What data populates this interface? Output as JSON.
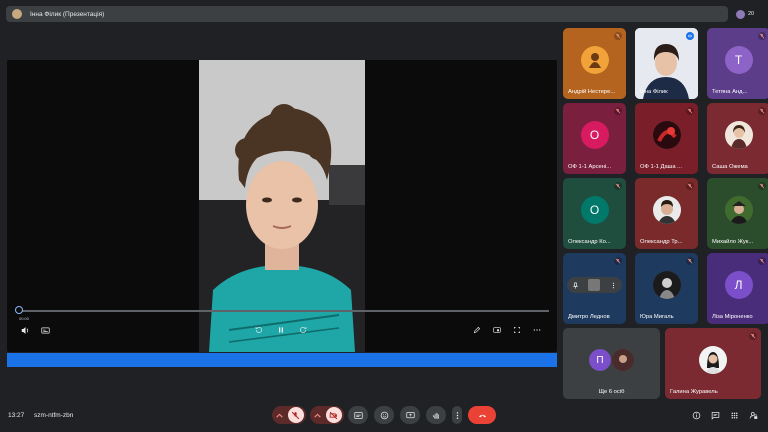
{
  "topbar": {
    "presentation_title": "Інна Філик (Презентація)",
    "people_count": "20"
  },
  "video": {
    "time": "00:00",
    "progress_fraction": 0.0
  },
  "participants": [
    {
      "name": "Андрій Нестере...",
      "avatar_type": "photo",
      "tile_color": "#b4641e",
      "muted": true
    },
    {
      "name": "Інна Філик",
      "avatar_type": "photo",
      "tile_color": "#d8dde6",
      "muted": false,
      "speaking": true,
      "selected": true
    },
    {
      "name": "Тетяна Анд...",
      "avatar_type": "letter",
      "letter": "Т",
      "tile_color": "#5b3d8a",
      "avatar_color": "#8e63c7",
      "muted": true
    },
    {
      "name": "ОФ 1-1 Арсені...",
      "avatar_type": "letter",
      "letter": "О",
      "tile_color": "#7a1f3d",
      "avatar_color": "#d81b60",
      "muted": true
    },
    {
      "name": "ОФ 1-1 Даша ...",
      "avatar_type": "photo",
      "tile_color": "#7a1f2a",
      "muted": true
    },
    {
      "name": "Саша Ожема",
      "avatar_type": "photo",
      "tile_color": "#7a2a30",
      "muted": true
    },
    {
      "name": "Олександр Ко...",
      "avatar_type": "letter",
      "letter": "О",
      "tile_color": "#1f4d3e",
      "avatar_color": "#00796b",
      "muted": true
    },
    {
      "name": "Олександр Тр...",
      "avatar_type": "photo",
      "tile_color": "#7a2a2a",
      "muted": true
    },
    {
      "name": "Михайло Жук...",
      "avatar_type": "photo",
      "tile_color": "#2b4d2b",
      "muted": true
    },
    {
      "name": "Дмитро Леднов",
      "avatar_type": "photo",
      "tile_color": "#1e3a5f",
      "muted": true
    },
    {
      "name": "Юра Мигаль",
      "avatar_type": "photo",
      "tile_color": "#1e3a5f",
      "muted": true
    },
    {
      "name": "Ліза Міроненко",
      "avatar_type": "letter",
      "letter": "Л",
      "tile_color": "#4a2d7a",
      "avatar_color": "#7b4fc9",
      "muted": true
    }
  ],
  "overflow_tile": {
    "label": "Ще 6 осіб",
    "letter": "П",
    "avatar_color": "#7b4fc9"
  },
  "last_tile": {
    "name": "Галина Журавель",
    "tile_color": "#7a2a30",
    "muted": true
  },
  "bottombar": {
    "clock": "13:27",
    "meeting_code": "szm-ntfm-zbn"
  },
  "colors": {
    "accent_blue": "#1a73e8",
    "end_call_red": "#ea4335",
    "muted_red": "#f28b82"
  }
}
